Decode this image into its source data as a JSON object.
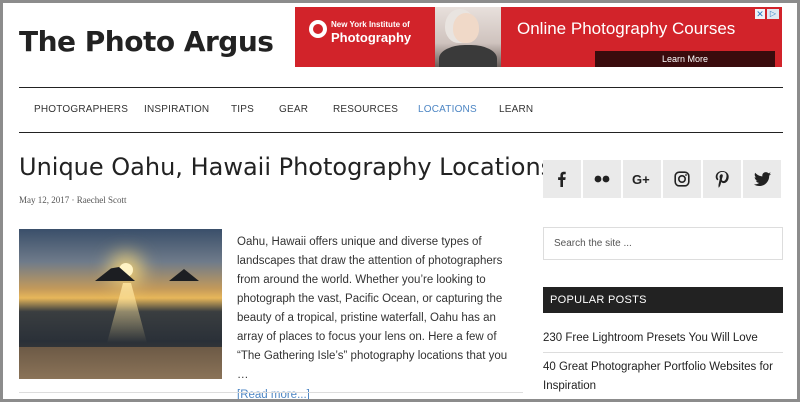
{
  "header": {
    "site_title": "The Photo Argus"
  },
  "ad": {
    "logo_line1": "New York Institute of",
    "logo_line2": "Photography",
    "headline": "Online Photography Courses",
    "cta": "Learn More",
    "adchoices_glyph": "▷",
    "close_glyph": "✕",
    "brand_color": "#d2232a"
  },
  "nav": {
    "items": [
      {
        "label": "PHOTOGRAPHERS"
      },
      {
        "label": "INSPIRATION"
      },
      {
        "label": "TIPS"
      },
      {
        "label": "GEAR"
      },
      {
        "label": "RESOURCES"
      },
      {
        "label": "LOCATIONS",
        "active": true
      },
      {
        "label": "LEARN"
      }
    ],
    "active_color": "#4d86c4"
  },
  "post": {
    "title": "Unique Oahu, Hawaii Photography Locations",
    "meta": "May 12, 2017 · Raechel Scott",
    "excerpt": "Oahu, Hawaii offers unique and diverse types of landscapes that draw the attention of photographers from around the world. Whether you’re looking to photograph the vast, Pacific Ocean, or capturing the beauty of a tropical, pristine waterfall, Oahu has an array of places to focus your lens on. Here a few of “The Gathering Isle’s” photography locations that you …",
    "read_more": "[Read more...]",
    "image_icon": "sunset-beach-photo"
  },
  "sidebar": {
    "social": [
      {
        "icon": "facebook-icon",
        "glyph": "f"
      },
      {
        "icon": "flickr-icon",
        "glyph": "●●"
      },
      {
        "icon": "google-plus-icon",
        "glyph": "G+"
      },
      {
        "icon": "instagram-icon",
        "glyph": ""
      },
      {
        "icon": "pinterest-icon",
        "glyph": "P"
      },
      {
        "icon": "twitter-icon",
        "glyph": ""
      }
    ],
    "search_placeholder": "Search the site ...",
    "popular_title": "POPULAR POSTS",
    "popular_posts": [
      {
        "title": "230 Free Lightroom Presets You Will Love"
      },
      {
        "title": "40 Great Photographer Portfolio Websites for Inspiration"
      }
    ]
  }
}
